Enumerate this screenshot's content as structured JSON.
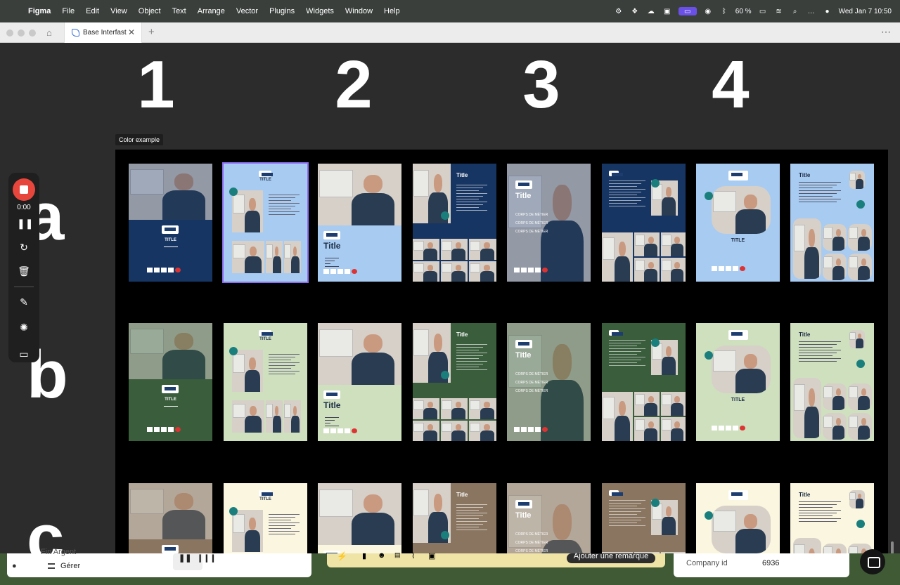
{
  "menubar": {
    "app": "Figma",
    "items": [
      "File",
      "Edit",
      "View",
      "Object",
      "Text",
      "Arrange",
      "Vector",
      "Plugins",
      "Widgets",
      "Window",
      "Help"
    ],
    "battery": "60 %",
    "datetime": "Wed Jan 7  10:50"
  },
  "tabs": {
    "file_tab": "Base Interfast"
  },
  "canvas": {
    "column_numbers": [
      "1",
      "2",
      "3",
      "4"
    ],
    "row_letters": [
      "a",
      "b",
      "c"
    ],
    "frame_label": "Color example"
  },
  "cards": {
    "title_caps": "TITLE",
    "title": "Title",
    "metier": "CORPS DE MÉTIER",
    "logo": "ECR"
  },
  "palettes": {
    "a": {
      "dark": "#173563",
      "light": "#a8cbf1",
      "text": "#ffffff",
      "accent": "#1a7f7c"
    },
    "b": {
      "dark": "#3a5d3c",
      "light": "#cfe0bf",
      "text": "#ffffff",
      "accent": "#1a7f7c"
    },
    "c": {
      "dark": "#8a7560",
      "light": "#fbf6df",
      "text": "#ffffff",
      "accent": "#1a7f7c"
    }
  },
  "recorder": {
    "time": "0:00"
  },
  "bottom": {
    "gerer": "Gérer",
    "overlapped_text": "Fin Argent",
    "remark_button": "Ajouter une remarque",
    "company_id_label": "Company id",
    "company_id_value": "6936"
  }
}
